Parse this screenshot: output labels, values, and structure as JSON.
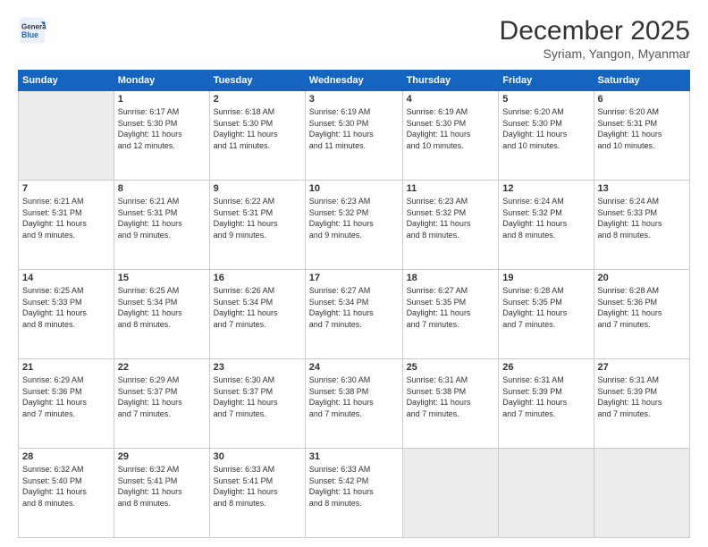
{
  "logo": {
    "general": "General",
    "blue": "Blue"
  },
  "header": {
    "title": "December 2025",
    "subtitle": "Syriam, Yangon, Myanmar"
  },
  "days_of_week": [
    "Sunday",
    "Monday",
    "Tuesday",
    "Wednesday",
    "Thursday",
    "Friday",
    "Saturday"
  ],
  "weeks": [
    [
      {
        "day": "",
        "info": ""
      },
      {
        "day": "1",
        "info": "Sunrise: 6:17 AM\nSunset: 5:30 PM\nDaylight: 11 hours\nand 12 minutes."
      },
      {
        "day": "2",
        "info": "Sunrise: 6:18 AM\nSunset: 5:30 PM\nDaylight: 11 hours\nand 11 minutes."
      },
      {
        "day": "3",
        "info": "Sunrise: 6:19 AM\nSunset: 5:30 PM\nDaylight: 11 hours\nand 11 minutes."
      },
      {
        "day": "4",
        "info": "Sunrise: 6:19 AM\nSunset: 5:30 PM\nDaylight: 11 hours\nand 10 minutes."
      },
      {
        "day": "5",
        "info": "Sunrise: 6:20 AM\nSunset: 5:30 PM\nDaylight: 11 hours\nand 10 minutes."
      },
      {
        "day": "6",
        "info": "Sunrise: 6:20 AM\nSunset: 5:31 PM\nDaylight: 11 hours\nand 10 minutes."
      }
    ],
    [
      {
        "day": "7",
        "info": "Sunrise: 6:21 AM\nSunset: 5:31 PM\nDaylight: 11 hours\nand 9 minutes."
      },
      {
        "day": "8",
        "info": "Sunrise: 6:21 AM\nSunset: 5:31 PM\nDaylight: 11 hours\nand 9 minutes."
      },
      {
        "day": "9",
        "info": "Sunrise: 6:22 AM\nSunset: 5:31 PM\nDaylight: 11 hours\nand 9 minutes."
      },
      {
        "day": "10",
        "info": "Sunrise: 6:23 AM\nSunset: 5:32 PM\nDaylight: 11 hours\nand 9 minutes."
      },
      {
        "day": "11",
        "info": "Sunrise: 6:23 AM\nSunset: 5:32 PM\nDaylight: 11 hours\nand 8 minutes."
      },
      {
        "day": "12",
        "info": "Sunrise: 6:24 AM\nSunset: 5:32 PM\nDaylight: 11 hours\nand 8 minutes."
      },
      {
        "day": "13",
        "info": "Sunrise: 6:24 AM\nSunset: 5:33 PM\nDaylight: 11 hours\nand 8 minutes."
      }
    ],
    [
      {
        "day": "14",
        "info": "Sunrise: 6:25 AM\nSunset: 5:33 PM\nDaylight: 11 hours\nand 8 minutes."
      },
      {
        "day": "15",
        "info": "Sunrise: 6:25 AM\nSunset: 5:34 PM\nDaylight: 11 hours\nand 8 minutes."
      },
      {
        "day": "16",
        "info": "Sunrise: 6:26 AM\nSunset: 5:34 PM\nDaylight: 11 hours\nand 7 minutes."
      },
      {
        "day": "17",
        "info": "Sunrise: 6:27 AM\nSunset: 5:34 PM\nDaylight: 11 hours\nand 7 minutes."
      },
      {
        "day": "18",
        "info": "Sunrise: 6:27 AM\nSunset: 5:35 PM\nDaylight: 11 hours\nand 7 minutes."
      },
      {
        "day": "19",
        "info": "Sunrise: 6:28 AM\nSunset: 5:35 PM\nDaylight: 11 hours\nand 7 minutes."
      },
      {
        "day": "20",
        "info": "Sunrise: 6:28 AM\nSunset: 5:36 PM\nDaylight: 11 hours\nand 7 minutes."
      }
    ],
    [
      {
        "day": "21",
        "info": "Sunrise: 6:29 AM\nSunset: 5:36 PM\nDaylight: 11 hours\nand 7 minutes."
      },
      {
        "day": "22",
        "info": "Sunrise: 6:29 AM\nSunset: 5:37 PM\nDaylight: 11 hours\nand 7 minutes."
      },
      {
        "day": "23",
        "info": "Sunrise: 6:30 AM\nSunset: 5:37 PM\nDaylight: 11 hours\nand 7 minutes."
      },
      {
        "day": "24",
        "info": "Sunrise: 6:30 AM\nSunset: 5:38 PM\nDaylight: 11 hours\nand 7 minutes."
      },
      {
        "day": "25",
        "info": "Sunrise: 6:31 AM\nSunset: 5:38 PM\nDaylight: 11 hours\nand 7 minutes."
      },
      {
        "day": "26",
        "info": "Sunrise: 6:31 AM\nSunset: 5:39 PM\nDaylight: 11 hours\nand 7 minutes."
      },
      {
        "day": "27",
        "info": "Sunrise: 6:31 AM\nSunset: 5:39 PM\nDaylight: 11 hours\nand 7 minutes."
      }
    ],
    [
      {
        "day": "28",
        "info": "Sunrise: 6:32 AM\nSunset: 5:40 PM\nDaylight: 11 hours\nand 8 minutes."
      },
      {
        "day": "29",
        "info": "Sunrise: 6:32 AM\nSunset: 5:41 PM\nDaylight: 11 hours\nand 8 minutes."
      },
      {
        "day": "30",
        "info": "Sunrise: 6:33 AM\nSunset: 5:41 PM\nDaylight: 11 hours\nand 8 minutes."
      },
      {
        "day": "31",
        "info": "Sunrise: 6:33 AM\nSunset: 5:42 PM\nDaylight: 11 hours\nand 8 minutes."
      },
      {
        "day": "",
        "info": ""
      },
      {
        "day": "",
        "info": ""
      },
      {
        "day": "",
        "info": ""
      }
    ]
  ]
}
